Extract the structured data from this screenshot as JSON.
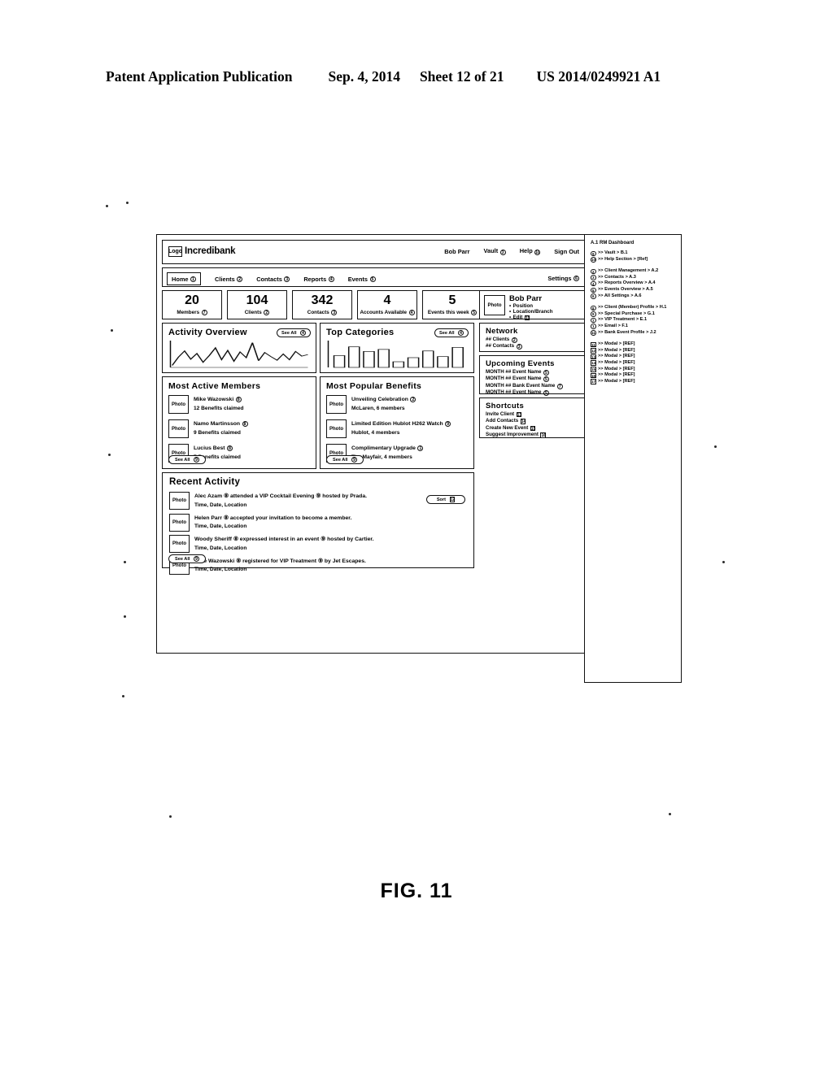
{
  "patent_header": {
    "publication": "Patent Application Publication",
    "date": "Sep. 4, 2014",
    "sheet": "Sheet 12 of 21",
    "number": "US 2014/0249921 A1"
  },
  "figure_label": "FIG. 11",
  "app": {
    "brand": "Incredibank",
    "logo_glyph": "Logo",
    "top_nav": [
      {
        "label": "Bob Parr",
        "icon": ""
      },
      {
        "label": "Vault",
        "icon": "3"
      },
      {
        "label": "Help",
        "icon": "10"
      },
      {
        "label": "Sign Out",
        "icon": ""
      }
    ],
    "main_nav": [
      {
        "label": "Home",
        "icon": "1",
        "active": true
      },
      {
        "label": "Clients",
        "icon": "2",
        "active": false
      },
      {
        "label": "Contacts",
        "icon": "3",
        "active": false
      },
      {
        "label": "Reports",
        "icon": "4",
        "active": false
      },
      {
        "label": "Events",
        "icon": "5",
        "active": false
      }
    ],
    "settings": {
      "label": "Settings",
      "icon": "6"
    },
    "stats": [
      {
        "value": "20",
        "label": "Members",
        "icon": "7"
      },
      {
        "value": "104",
        "label": "Clients",
        "icon": "2"
      },
      {
        "value": "342",
        "label": "Contacts",
        "icon": "3"
      },
      {
        "value": "4",
        "label": "Accounts Available",
        "icon": "4"
      },
      {
        "value": "5",
        "label": "Events this week",
        "icon": "5"
      }
    ],
    "profile": {
      "name": "Bob Parr",
      "photo_label": "Photo",
      "lines": [
        "Position",
        "Location/Branch",
        "Edit"
      ],
      "edit_icon": "11"
    },
    "activity_overview": {
      "title": "Activity Overview",
      "see_all": "See All",
      "see_all_icon": "4"
    },
    "top_categories": {
      "title": "Top Categories",
      "see_all": "See All",
      "see_all_icon": "4"
    },
    "most_active_members": {
      "title": "Most Active Members",
      "see_all": "See All",
      "see_all_icon": "9",
      "photo_label": "Photo",
      "items": [
        {
          "name": "Mike Wazowski",
          "icon": "8",
          "detail": "12 Benefits claimed"
        },
        {
          "name": "Namo Martinsson",
          "icon": "8",
          "detail": "9 Benefits claimed"
        },
        {
          "name": "Lucius Best",
          "icon": "8",
          "detail": "7 Benefits claimed"
        }
      ]
    },
    "most_popular_benefits": {
      "title": "Most Popular Benefits",
      "see_all": "See All",
      "see_all_icon": "9",
      "photo_label": "Photo",
      "items": [
        {
          "name": "Unveiling Celebration",
          "icon": "2",
          "detail": "McLaren, 6 members"
        },
        {
          "name": "Limited Edition Hublot H262 Watch",
          "icon": "9",
          "detail": "Hublot, 4 members"
        },
        {
          "name": "Complimentary Upgrade",
          "icon": "1",
          "detail": "The Mayfair, 4 members"
        }
      ]
    },
    "recent_activity": {
      "title": "Recent Activity",
      "see_all": "See All",
      "see_all_icon": "9",
      "filter": "Sort",
      "filter_icon": "12",
      "photo_label": "Photo",
      "items": [
        {
          "text": "Alec Azam ⑧ attended a VIP Cocktail Evening ⑨ hosted by Prada.",
          "meta": "Time, Date, Location"
        },
        {
          "text": "Helen Parr ⑧ accepted your invitation to become a member.",
          "meta": "Time, Date, Location"
        },
        {
          "text": "Woody Sheriff ⑧ expressed interest in an event ⑨ hosted by Cartier.",
          "meta": "Time, Date, Location"
        },
        {
          "text": "Mike Wazowski ⑧ registered for VIP Treatment ⑨ by Jet Escapes.",
          "meta": "Time, Date, Location"
        }
      ]
    },
    "network": {
      "title": "Network",
      "items": [
        {
          "label": "## Clients",
          "icon": "2"
        },
        {
          "label": "## Contacts",
          "icon": "3"
        }
      ]
    },
    "upcoming_events": {
      "title": "Upcoming Events",
      "items": [
        {
          "label": "MONTH ## Event Name",
          "icon": "5"
        },
        {
          "label": "MONTH ## Event Name",
          "icon": "5"
        },
        {
          "label": "MONTH ## Bank Event Name",
          "icon": "7"
        },
        {
          "label": "MONTH ## Event Name",
          "icon": "5"
        }
      ]
    },
    "shortcuts": {
      "title": "Shortcuts",
      "items": [
        {
          "label": "Invite Client",
          "icon": "13"
        },
        {
          "label": "Add Contacts",
          "icon": "14"
        },
        {
          "label": "Create New Event",
          "icon": "15"
        },
        {
          "label": "Suggest Improvement",
          "icon": "16"
        }
      ]
    }
  },
  "annotations": {
    "title": "A.1 RM Dashboard",
    "groups": [
      {
        "items": [
          {
            "icon": "9",
            "shape": "circle",
            "text": ">> Vault > B.1"
          },
          {
            "icon": "10",
            "shape": "circle",
            "text": ">> Help Section > [Ref]"
          }
        ]
      },
      {
        "items": [
          {
            "icon": "2",
            "shape": "circle",
            "text": ">> Client Management > A.2"
          },
          {
            "icon": "3",
            "shape": "circle",
            "text": ">> Contacts > A.3"
          },
          {
            "icon": "4",
            "shape": "circle",
            "text": ">> Reports Overview > A.4"
          },
          {
            "icon": "5",
            "shape": "circle",
            "text": ">> Events Overview > A.5"
          },
          {
            "icon": "6",
            "shape": "circle",
            "text": ">> All Settings > A.6"
          }
        ]
      },
      {
        "items": [
          {
            "icon": "8",
            "shape": "circle",
            "text": ">> Client (Member) Profile > H.1"
          },
          {
            "icon": "9",
            "shape": "circle",
            "text": ">> Special Purchase > G.1"
          },
          {
            "icon": "7",
            "shape": "circle",
            "text": ">> VIP Treatment > E.1"
          },
          {
            "icon": "1",
            "shape": "circle",
            "text": ">> Email > F.1"
          },
          {
            "icon": "11",
            "shape": "circle",
            "text": ">> Bank Event Profile > J.2"
          }
        ]
      },
      {
        "items": [
          {
            "icon": "11",
            "shape": "square",
            "text": ">> Modal > [REF]"
          },
          {
            "icon": "12",
            "shape": "square",
            "text": ">> Modal > [REF]"
          },
          {
            "icon": "13",
            "shape": "square",
            "text": ">> Modal > [REF]"
          },
          {
            "icon": "14",
            "shape": "square",
            "text": ">> Modal > [REF]"
          },
          {
            "icon": "15",
            "shape": "square",
            "text": ">> Modal > [REF]"
          },
          {
            "icon": "16",
            "shape": "square",
            "text": ">> Modal > [REF]"
          },
          {
            "icon": "17",
            "shape": "square",
            "text": ">> Modal > [REF]"
          }
        ]
      }
    ]
  },
  "chart_data": [
    {
      "type": "line",
      "title": "Activity Overview",
      "x": [
        0,
        1,
        2,
        3,
        4,
        5,
        6,
        7,
        8,
        9,
        10,
        11,
        12,
        13,
        14,
        15,
        16,
        17,
        18,
        19,
        20,
        21,
        22
      ],
      "values": [
        8,
        40,
        64,
        32,
        54,
        20,
        46,
        76,
        30,
        66,
        24,
        60,
        38,
        96,
        26,
        58,
        42,
        28,
        52,
        30,
        62,
        44,
        50
      ],
      "xlabel": "",
      "ylabel": "",
      "ylim": [
        0,
        100
      ],
      "grid": false,
      "legend": "none"
    },
    {
      "type": "bar",
      "title": "Top Categories",
      "categories": [
        "1",
        "2",
        "3",
        "4",
        "5",
        "6",
        "7",
        "8",
        "9"
      ],
      "values": [
        46,
        80,
        62,
        70,
        22,
        38,
        64,
        42,
        78
      ],
      "xlabel": "",
      "ylabel": "",
      "ylim": [
        0,
        100
      ],
      "grid": false,
      "legend": "none"
    }
  ]
}
